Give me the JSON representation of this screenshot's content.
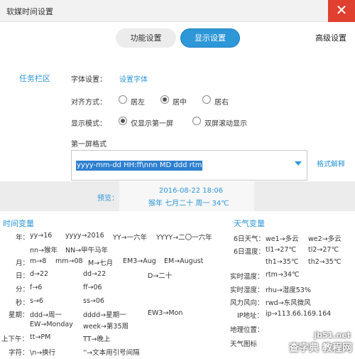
{
  "window": {
    "title": "软媒时间设置",
    "close_glyph": "✕"
  },
  "tabs": [
    {
      "label": "功能设置",
      "active": false
    },
    {
      "label": "显示设置",
      "active": true
    },
    {
      "label": "高级设置",
      "active": false
    }
  ],
  "section": {
    "label": "任务栏区"
  },
  "font_row": {
    "label": "字体设置：",
    "link": "设置字体"
  },
  "align_row": {
    "label": "对齐方式：",
    "options": [
      {
        "label": "居左",
        "selected": false
      },
      {
        "label": "居中",
        "selected": true
      },
      {
        "label": "居右",
        "selected": false
      }
    ]
  },
  "mode_row": {
    "label": "显示模式：",
    "options": [
      {
        "label": "仅显示第一屏",
        "selected": true
      },
      {
        "label": "双屏滚动显示",
        "selected": false
      }
    ]
  },
  "format": {
    "label": "第一屏格式",
    "value": "yyyy-mm-dd HH:ff\\nnn MD ddd rtm",
    "explain_link": "格式解释"
  },
  "preview": {
    "label": "预览：",
    "line1": "2016-08-22 18:06",
    "line2": "猴年 七月二十 周一 34℃"
  },
  "time_vars": {
    "title": "时间变量",
    "rows": [
      {
        "key": "年：",
        "items": [
          "yy→16",
          "yyyy→2016",
          "YY→一六年",
          "YYYY→二〇一六年"
        ]
      },
      {
        "key": "",
        "items": [
          "nn→猴年",
          "NN→甲午马年"
        ]
      },
      {
        "key": "月：",
        "items": [
          "m→8",
          "mm→08",
          "M→七月",
          "EM3→Aug",
          "EM→August"
        ]
      },
      {
        "key": "日：",
        "items": [
          "d→22",
          "dd→22",
          "D→二十"
        ]
      },
      {
        "key": "分：",
        "items": [
          "f→6",
          "ff→06"
        ]
      },
      {
        "key": "秒：",
        "items": [
          "s→6",
          "ss→06"
        ]
      },
      {
        "key": "星期：",
        "items": [
          "ddd→周一",
          "dddd→星期一",
          "EW3→Mon"
        ]
      },
      {
        "key": "",
        "items": [
          "EW→Monday",
          "week→第35周"
        ]
      },
      {
        "key": "上下午：",
        "items": [
          "tt→PM",
          "TT→晚上"
        ]
      },
      {
        "key": "字符：",
        "items": [
          "\\n→换行",
          "''→文本用引号间隔"
        ]
      }
    ]
  },
  "weather_vars": {
    "title": "天气变量",
    "rows": [
      {
        "key": "6日天气：",
        "items": [
          "we1→多云",
          "we2→多云"
        ]
      },
      {
        "key": "6日温度：",
        "items": [
          "tl1→27℃",
          "tl2→27℃"
        ]
      },
      {
        "key": "",
        "items": [
          "th1→35℃",
          "th2→35℃"
        ]
      },
      {
        "key": "实时温度：",
        "items": [
          "rtm→34℃"
        ]
      },
      {
        "key": "实时湿度：",
        "items": [
          "rhu→湿度53%"
        ]
      },
      {
        "key": "风力风向：",
        "items": [
          "rwd→东风微风"
        ]
      },
      {
        "key": "IP地址：",
        "items": [
          "ip→113.66.169.164"
        ]
      },
      {
        "key": "地理位置：",
        "items": []
      },
      {
        "key": "天气图标",
        "items": []
      }
    ]
  },
  "watermark": {
    "line1": "jb51.net",
    "line2": "查字典 教程网"
  },
  "colors": {
    "accent": "#2d97d8",
    "close": "#e0402f",
    "selection": "#2c7fd0"
  }
}
